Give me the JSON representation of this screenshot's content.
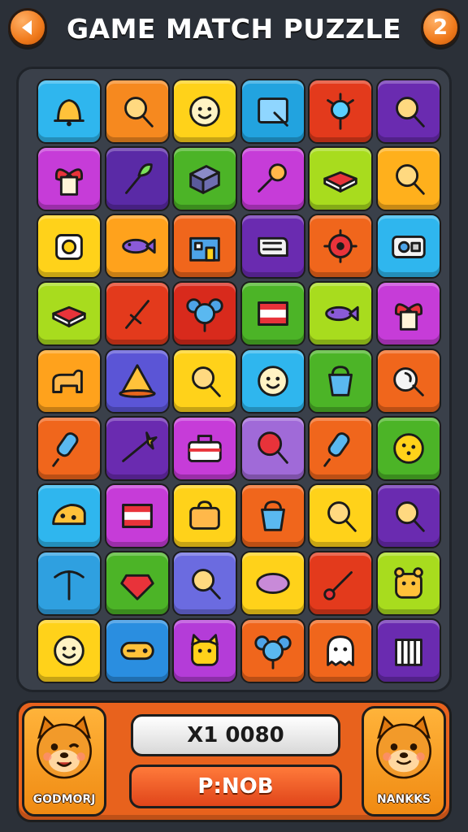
{
  "header": {
    "title": "GAME MATCH PUZZLE",
    "right_button_label": "2"
  },
  "board": {
    "rows": [
      [
        {
          "color": "#2fb6ee",
          "icon": "bell-icon"
        },
        {
          "color": "#f6891f",
          "icon": "magnifier-icon"
        },
        {
          "color": "#ffd21a",
          "icon": "face-icon"
        },
        {
          "color": "#22a3df",
          "icon": "frame-icon"
        },
        {
          "color": "#e33a1c",
          "icon": "sun-icon"
        },
        {
          "color": "#6a2bb0",
          "icon": "magnifier-icon"
        }
      ],
      [
        {
          "color": "#c63cd8",
          "icon": "gift-bow-icon"
        },
        {
          "color": "#5a2aa6",
          "icon": "leaf-wand-icon"
        },
        {
          "color": "#4cb427",
          "icon": "box-icon"
        },
        {
          "color": "#c63cd8",
          "icon": "key-icon"
        },
        {
          "color": "#a8dc1e",
          "icon": "book-icon"
        },
        {
          "color": "#ffb01c",
          "icon": "magnifier-icon"
        }
      ],
      [
        {
          "color": "#ffd21a",
          "icon": "camera-icon"
        },
        {
          "color": "#ffa21c",
          "icon": "fish-icon"
        },
        {
          "color": "#f0661c",
          "icon": "house-icon"
        },
        {
          "color": "#6a2bb0",
          "icon": "scroll-icon"
        },
        {
          "color": "#f0661c",
          "icon": "gear-icon"
        },
        {
          "color": "#2fb6ee",
          "icon": "radio-icon"
        }
      ],
      [
        {
          "color": "#a8dc1e",
          "icon": "book-icon"
        },
        {
          "color": "#e33a1c",
          "icon": "sword-icon"
        },
        {
          "color": "#d82a1c",
          "icon": "mouse-icon"
        },
        {
          "color": "#4cb427",
          "icon": "flag-icon"
        },
        {
          "color": "#a8dc1e",
          "icon": "fish-icon"
        },
        {
          "color": "#c63cd8",
          "icon": "gift-bow-icon"
        }
      ],
      [
        {
          "color": "#ffa21c",
          "icon": "dog-icon"
        },
        {
          "color": "#5b55d6",
          "icon": "tent-icon"
        },
        {
          "color": "#ffd21a",
          "icon": "magnifier-icon"
        },
        {
          "color": "#2fb6ee",
          "icon": "face-icon"
        },
        {
          "color": "#4cb427",
          "icon": "bucket-icon"
        },
        {
          "color": "#f0661c",
          "icon": "shell-icon"
        }
      ],
      [
        {
          "color": "#f0661c",
          "icon": "popsicle-icon"
        },
        {
          "color": "#6a2bb0",
          "icon": "wand-icon"
        },
        {
          "color": "#c63cd8",
          "icon": "toolbox-icon"
        },
        {
          "color": "#a06ad8",
          "icon": "lollipop-icon"
        },
        {
          "color": "#f0661c",
          "icon": "popsicle-icon"
        },
        {
          "color": "#4cb427",
          "icon": "cookie-icon"
        }
      ],
      [
        {
          "color": "#2fb6ee",
          "icon": "cheese-icon"
        },
        {
          "color": "#c63cd8",
          "icon": "flag-icon"
        },
        {
          "color": "#ffd21a",
          "icon": "bag-icon"
        },
        {
          "color": "#f0661c",
          "icon": "bucket-icon"
        },
        {
          "color": "#ffd21a",
          "icon": "magnifier-icon"
        },
        {
          "color": "#6a2bb0",
          "icon": "magnifier-icon"
        }
      ],
      [
        {
          "color": "#2fa0e0",
          "icon": "pickaxe-icon"
        },
        {
          "color": "#4cb427",
          "icon": "gem-icon"
        },
        {
          "color": "#6b6be0",
          "icon": "magnifier-icon"
        },
        {
          "color": "#ffd21a",
          "icon": "lemon-icon"
        },
        {
          "color": "#e33a1c",
          "icon": "brush-icon"
        },
        {
          "color": "#a8dc1e",
          "icon": "bear-icon"
        }
      ],
      [
        {
          "color": "#ffd21a",
          "icon": "face-icon"
        },
        {
          "color": "#2a8ee0",
          "icon": "controller-icon"
        },
        {
          "color": "#b43cd8",
          "icon": "cat-icon"
        },
        {
          "color": "#f0661c",
          "icon": "mouse-icon"
        },
        {
          "color": "#f0661c",
          "icon": "ghost-icon"
        },
        {
          "color": "#6a2bb0",
          "icon": "cage-icon"
        }
      ]
    ]
  },
  "footer": {
    "left_character": {
      "label": "GODMORJ",
      "icon": "fox-face-icon"
    },
    "right_character": {
      "label": "NANKKS",
      "icon": "fox-face-icon"
    },
    "score_text": "X1 0080",
    "action_label": "P:NOB"
  }
}
